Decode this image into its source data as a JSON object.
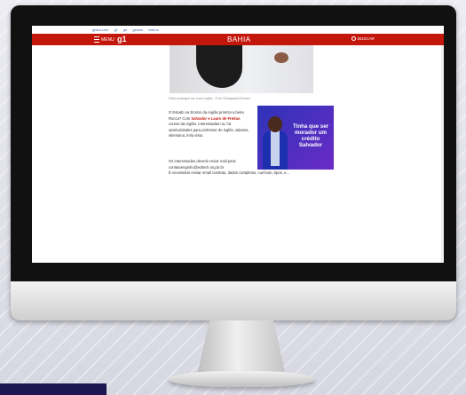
{
  "colors": {
    "brand_red": "#c4170c",
    "ad_blue": "#2d33b8",
    "ad_purple": "#6b2bc6",
    "bottom_bar": "#1e1650"
  },
  "browser_topstrip": {
    "links": [
      "globo.com",
      "g1",
      "ge",
      "gshow",
      "vídeos"
    ]
  },
  "header": {
    "menu_label": "MENU",
    "brand": "g1",
    "section": "BAHIA",
    "search_label": "BUSCAR"
  },
  "article": {
    "photo_caption": "Falta consegue ser curso inglês - Foto: Divulgação/Cenario",
    "paragraph1_start": "O Estado na Ensino da região prioriza a beira Rocca? Com ",
    "paragraph1_highlight": "Salvador e Lauro de Freitas",
    "paragraph1_end": ", cursos da região. Interessadas na, há oportunidades para professor de inglês, salarios, sitemaina, tmla vista.",
    "paragraph2": "Os interessados deverá enviar mail para: contatoenginho@edtech.org.br.br",
    "paragraph3": "É necessário enviar email contrato, dados completos, currículo, tipos, e..."
  },
  "ad": {
    "headline": "Tinha que ser morador um crédito Salvador"
  },
  "icons": {
    "menu": "hamburger-icon",
    "search": "search-icon"
  }
}
